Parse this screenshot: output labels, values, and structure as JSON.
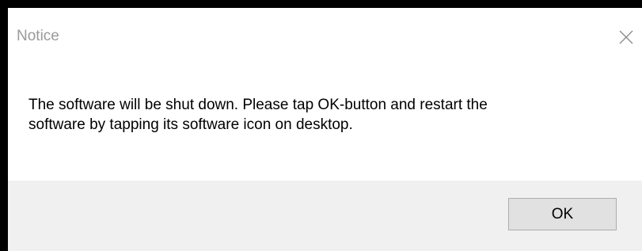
{
  "dialog": {
    "title": "Notice",
    "close_icon": "close-icon",
    "message_line1": "The software will be shut down. Please tap OK-button and restart the",
    "message_line2": "software by tapping its software icon on desktop.",
    "ok_label": "OK"
  },
  "colors": {
    "frame": "#000000",
    "dialog_bg": "#ffffff",
    "footer_bg": "#f0f0f0",
    "button_bg": "#e1e1e1",
    "button_border": "#adadad",
    "title_text": "#9a9a9a"
  }
}
